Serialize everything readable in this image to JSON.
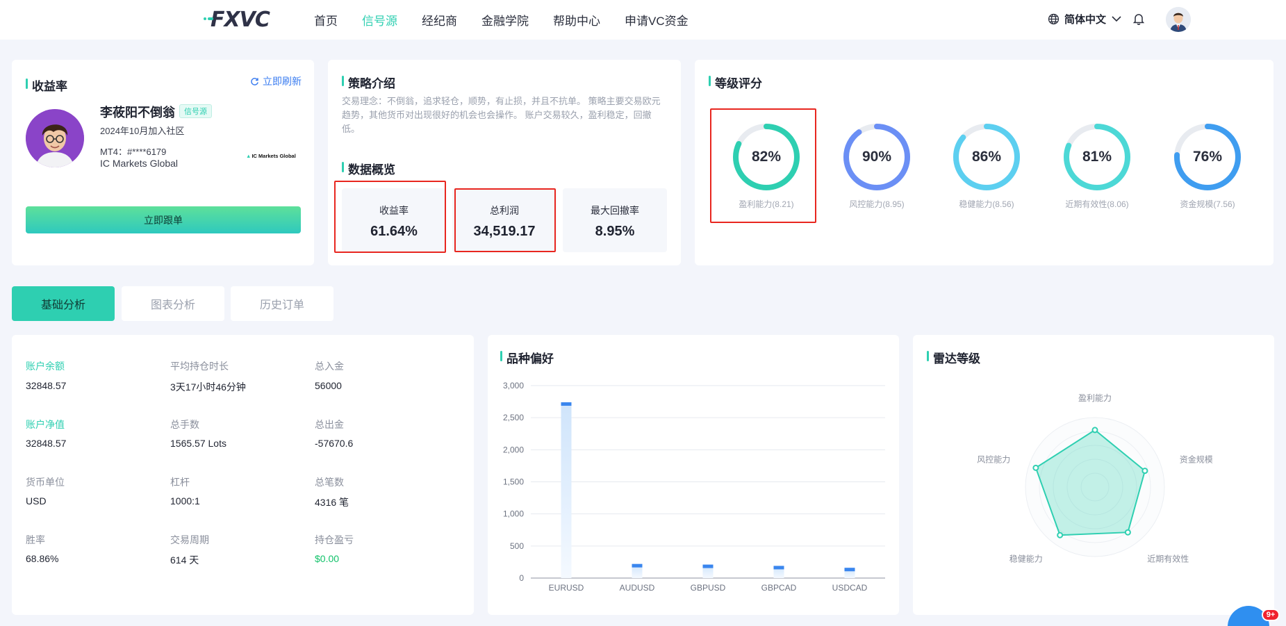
{
  "header": {
    "logo_text": "FXVC",
    "nav": [
      "首页",
      "信号源",
      "经纪商",
      "金融学院",
      "帮助中心",
      "申请VC资金"
    ],
    "active_nav": "信号源",
    "language": "简体中文"
  },
  "profile_card": {
    "title": "收益率",
    "refresh": "立即刷新",
    "name": "李莜阳不倒翁",
    "tag": "信号源",
    "joined": "2024年10月加入社区",
    "account": "MT4：#****6179",
    "broker": "IC Markets Global",
    "broker_logo": "IC Markets Global",
    "follow_button": "立即跟单"
  },
  "strategy_card": {
    "title": "策略介绍",
    "description": "交易理念：不倒翁，追求轻仓，顺势，有止损，并且不抗单。 策略主要交易欧元趋势，其他货币对出现很好的机会也会操作。 账户交易较久，盈利稳定，回撤低。",
    "overview_title": "数据概览",
    "stats": [
      {
        "label": "收益率",
        "value": "61.64%"
      },
      {
        "label": "总利润",
        "value": "34,519.17"
      },
      {
        "label": "最大回撤率",
        "value": "8.95%"
      }
    ]
  },
  "rating_card": {
    "title": "等级评分",
    "rings": [
      {
        "pct": "82%",
        "value": 82,
        "label": "盈利能力(8.21)",
        "color": "#2ecfb1"
      },
      {
        "pct": "90%",
        "value": 90,
        "label": "风控能力(8.95)",
        "color": "#6b8ff5"
      },
      {
        "pct": "86%",
        "value": 86,
        "label": "稳健能力(8.56)",
        "color": "#5ccff0"
      },
      {
        "pct": "81%",
        "value": 81,
        "label": "近期有效性(8.06)",
        "color": "#4cd8d6"
      },
      {
        "pct": "76%",
        "value": 76,
        "label": "资金规模(7.56)",
        "color": "#3f9df0"
      }
    ]
  },
  "tabs": [
    "基础分析",
    "图表分析",
    "历史订单"
  ],
  "active_tab": "基础分析",
  "stats_card": {
    "items": [
      {
        "label": "账户余额",
        "value": "32848.57",
        "label_color": "green"
      },
      {
        "label": "平均持仓时长",
        "value": "3天17小时46分钟"
      },
      {
        "label": "总入金",
        "value": "56000"
      },
      {
        "label": "账户净值",
        "value": "32848.57",
        "label_color": "green"
      },
      {
        "label": "总手数",
        "value": "1565.57 Lots"
      },
      {
        "label": "总出金",
        "value": "-57670.6"
      },
      {
        "label": "货币单位",
        "value": "USD"
      },
      {
        "label": "杠杆",
        "value": "1000:1"
      },
      {
        "label": "总笔数",
        "value": "4316 笔"
      },
      {
        "label": "胜率",
        "value": "68.86%"
      },
      {
        "label": "交易周期",
        "value": "614 天"
      },
      {
        "label": "持仓盈亏",
        "value": "$0.00",
        "value_color": "green"
      }
    ]
  },
  "pref_card": {
    "title": "品种偏好"
  },
  "radar_card": {
    "title": "雷达等级",
    "axes": [
      "盈利能力",
      "资金规模",
      "近期有效性",
      "稳健能力",
      "风控能力"
    ]
  },
  "chart_data": [
    {
      "type": "bar",
      "title": "品种偏好",
      "categories": [
        "EURUSD",
        "AUDUSD",
        "GBPUSD",
        "GBPCAD",
        "USDCAD"
      ],
      "values": [
        2740,
        220,
        210,
        190,
        160
      ],
      "ylim": [
        0,
        3000
      ],
      "yticks": [
        "0",
        "500",
        "1,000",
        "1,500",
        "2,000",
        "2,500",
        "3,000"
      ],
      "grid": true
    },
    {
      "type": "radar",
      "title": "雷达等级",
      "axes": [
        "盈利能力",
        "资金规模",
        "近期有效性",
        "稳健能力",
        "风控能力"
      ],
      "values": [
        8.21,
        7.56,
        8.06,
        8.56,
        8.95
      ],
      "max": 10
    }
  ],
  "chat": {
    "badge": "9+"
  }
}
